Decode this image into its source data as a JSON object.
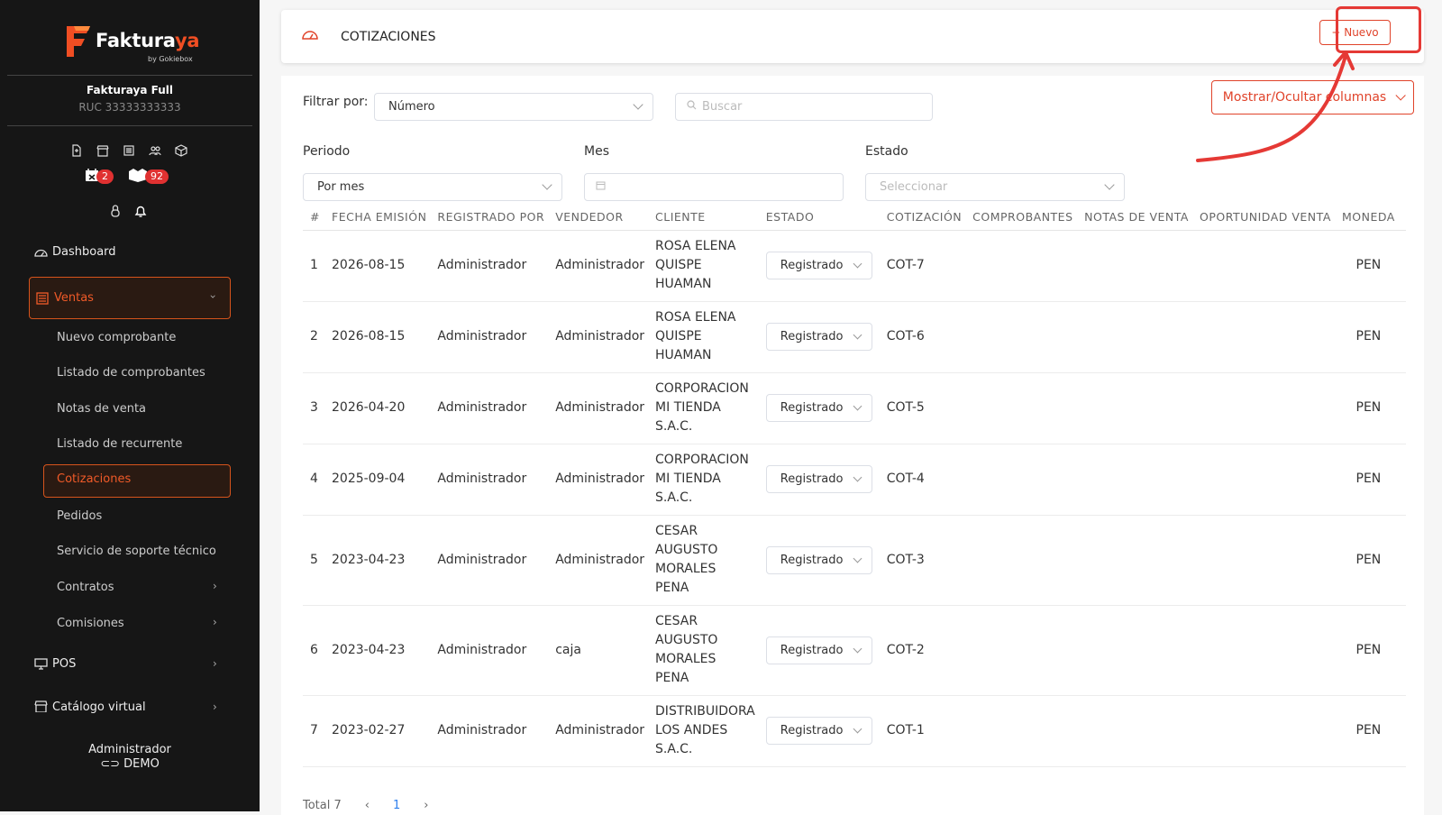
{
  "brand": {
    "name_main": "Faktura",
    "name_accent": "ya",
    "sub": "by Gokiebox",
    "accent_color": "#f04e23"
  },
  "company": {
    "name": "Fakturaya Full",
    "ruc": "RUC 33333333333"
  },
  "badges": {
    "calendar_count": "2",
    "box_count": "92"
  },
  "sidebar": {
    "dashboard": "Dashboard",
    "ventas": "Ventas",
    "ventas_items": [
      "Nuevo comprobante",
      "Listado de comprobantes",
      "Notas de venta",
      "Listado de recurrente",
      "Cotizaciones",
      "Pedidos",
      "Servicio de soporte técnico",
      "Contratos",
      "Comisiones"
    ],
    "pos": "POS",
    "catalogo": "Catálogo virtual"
  },
  "user": {
    "name": "Administrador",
    "mode": "DEMO"
  },
  "header": {
    "title": "COTIZACIONES",
    "new_button": "+ Nuevo"
  },
  "filters": {
    "filter_label": "Filtrar por:",
    "filter_value": "Número",
    "search_placeholder": "Buscar",
    "columns_button": "Mostrar/Ocultar columnas",
    "periodo_label": "Periodo",
    "periodo_value": "Por mes",
    "mes_label": "Mes",
    "estado_label": "Estado",
    "estado_placeholder": "Seleccionar"
  },
  "table": {
    "headers": [
      "#",
      "FECHA EMISIÓN",
      "REGISTRADO POR",
      "VENDEDOR",
      "CLIENTE",
      "ESTADO",
      "COTIZACIÓN",
      "COMPROBANTES",
      "NOTAS DE VENTA",
      "OPORTUNIDAD VENTA",
      "MONEDA"
    ],
    "rows": [
      {
        "n": "1",
        "fecha": "2026-08-15",
        "registrado": "Administrador",
        "vendedor": "Administrador",
        "cliente": [
          "ROSA ELENA",
          "QUISPE",
          "HUAMAN"
        ],
        "estado": "Registrado",
        "cotizacion": "COT-7",
        "moneda": "PEN"
      },
      {
        "n": "2",
        "fecha": "2026-08-15",
        "registrado": "Administrador",
        "vendedor": "Administrador",
        "cliente": [
          "ROSA ELENA",
          "QUISPE",
          "HUAMAN"
        ],
        "estado": "Registrado",
        "cotizacion": "COT-6",
        "moneda": "PEN"
      },
      {
        "n": "3",
        "fecha": "2026-04-20",
        "registrado": "Administrador",
        "vendedor": "Administrador",
        "cliente": [
          "CORPORACION",
          "MI TIENDA",
          "S.A.C."
        ],
        "estado": "Registrado",
        "cotizacion": "COT-5",
        "moneda": "PEN"
      },
      {
        "n": "4",
        "fecha": "2025-09-04",
        "registrado": "Administrador",
        "vendedor": "Administrador",
        "cliente": [
          "CORPORACION",
          "MI TIENDA",
          "S.A.C."
        ],
        "estado": "Registrado",
        "cotizacion": "COT-4",
        "moneda": "PEN"
      },
      {
        "n": "5",
        "fecha": "2023-04-23",
        "registrado": "Administrador",
        "vendedor": "Administrador",
        "cliente": [
          "CESAR",
          "AUGUSTO",
          "MORALES",
          "PENA"
        ],
        "estado": "Registrado",
        "cotizacion": "COT-3",
        "moneda": "PEN"
      },
      {
        "n": "6",
        "fecha": "2023-04-23",
        "registrado": "Administrador",
        "vendedor": "caja",
        "cliente": [
          "CESAR",
          "AUGUSTO",
          "MORALES",
          "PENA"
        ],
        "estado": "Registrado",
        "cotizacion": "COT-2",
        "moneda": "PEN"
      },
      {
        "n": "7",
        "fecha": "2023-02-27",
        "registrado": "Administrador",
        "vendedor": "Administrador",
        "cliente": [
          "DISTRIBUIDORA",
          "LOS ANDES",
          "S.A.C."
        ],
        "estado": "Registrado",
        "cotizacion": "COT-1",
        "moneda": "PEN"
      }
    ]
  },
  "pager": {
    "total": "Total 7",
    "current": "1"
  }
}
